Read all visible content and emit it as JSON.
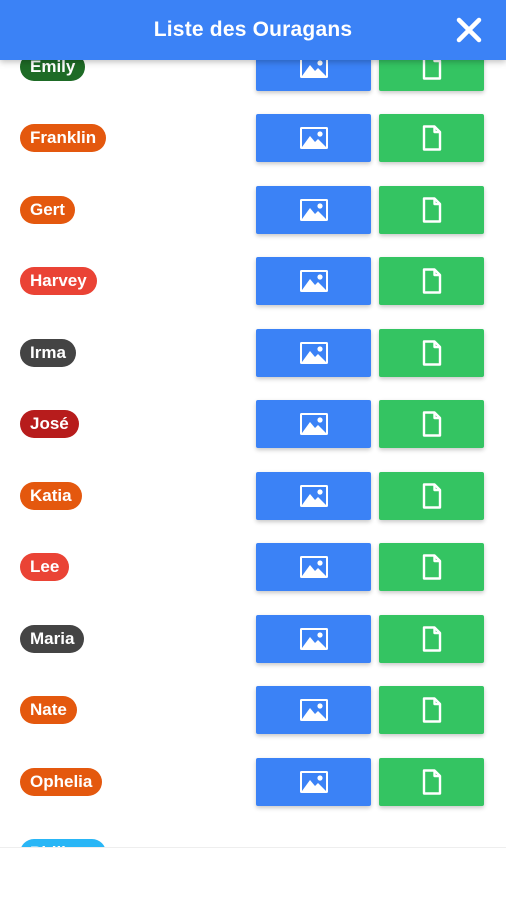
{
  "header": {
    "title": "Liste des Ouragans",
    "close_icon": "close-icon"
  },
  "colors": {
    "header_bg": "#3b82f6",
    "image_button": "#3b82f6",
    "document_button": "#34c462"
  },
  "icons": {
    "image_button": "image-icon",
    "document_button": "document-icon"
  },
  "hurricanes": [
    {
      "name": "Emily",
      "color": "#1e6b26"
    },
    {
      "name": "Franklin",
      "color": "#e4580e"
    },
    {
      "name": "Gert",
      "color": "#e4580e"
    },
    {
      "name": "Harvey",
      "color": "#ea4335"
    },
    {
      "name": "Irma",
      "color": "#444444"
    },
    {
      "name": "José",
      "color": "#b71c1c"
    },
    {
      "name": "Katia",
      "color": "#e4580e"
    },
    {
      "name": "Lee",
      "color": "#ea4335"
    },
    {
      "name": "Maria",
      "color": "#444444"
    },
    {
      "name": "Nate",
      "color": "#e4580e"
    },
    {
      "name": "Ophelia",
      "color": "#e4580e"
    },
    {
      "name": "Philippe",
      "color": "#29b6f6"
    }
  ]
}
